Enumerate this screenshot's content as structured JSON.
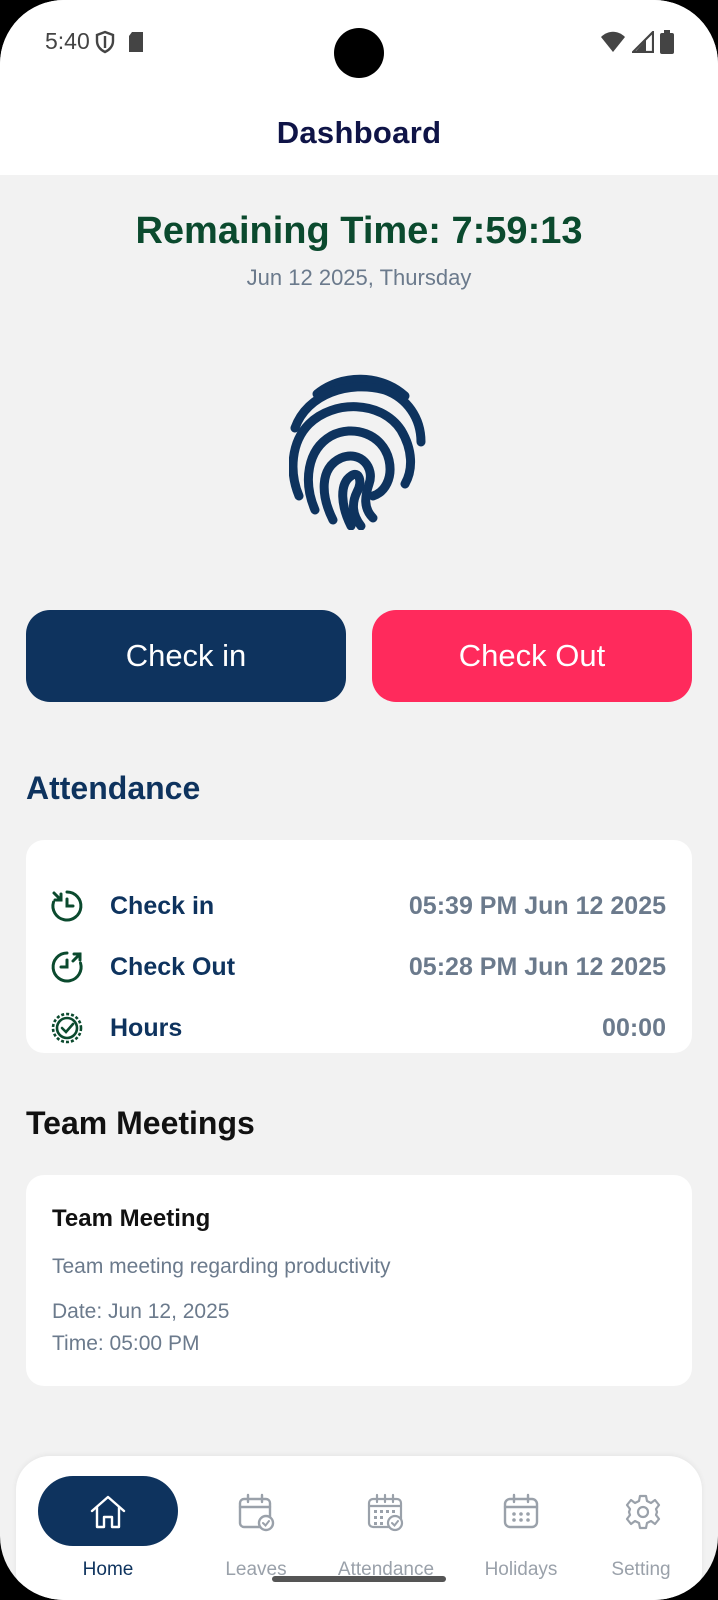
{
  "status": {
    "time": "5:40"
  },
  "appbar": {
    "title": "Dashboard"
  },
  "timer": {
    "remaining": "Remaining Time: 7:59:13",
    "date": "Jun 12 2025, Thursday"
  },
  "actions": {
    "check_in": "Check in",
    "check_out": "Check Out"
  },
  "attendance": {
    "title": "Attendance",
    "rows": [
      {
        "label": "Check in",
        "value": "05:39 PM Jun 12 2025"
      },
      {
        "label": "Check Out",
        "value": "05:28 PM Jun 12 2025"
      },
      {
        "label": "Hours",
        "value": "00:00"
      }
    ]
  },
  "meetings": {
    "title": "Team Meetings",
    "items": [
      {
        "title": "Team Meeting",
        "description": "Team meeting regarding productivity",
        "date": "Date: Jun 12, 2025",
        "time": "Time: 05:00 PM"
      }
    ]
  },
  "nav": {
    "items": [
      {
        "label": "Home",
        "icon": "home-icon",
        "active": true
      },
      {
        "label": "Leaves",
        "icon": "calendar-check-icon"
      },
      {
        "label": "Attendance",
        "icon": "calendar-grid-check-icon"
      },
      {
        "label": "Holidays",
        "icon": "calendar-icon"
      },
      {
        "label": "Setting",
        "icon": "gear-icon"
      }
    ]
  },
  "colors": {
    "primary": "#0e335e",
    "accent": "#ff2a5c",
    "timer_green": "#0b4a2e",
    "title_navy": "#0f1447",
    "muted": "#6b7a8c",
    "background": "#f2f2f2"
  }
}
